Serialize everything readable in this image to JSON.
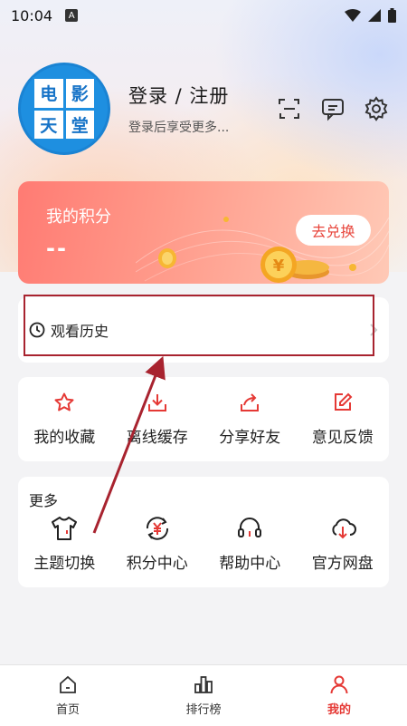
{
  "status_bar": {
    "time": "10:04",
    "notification_badge": "A"
  },
  "profile": {
    "avatar_chars": [
      "电",
      "影",
      "天",
      "堂"
    ],
    "login_title": "登录 / 注册",
    "login_subtitle": "登录后享受更多..."
  },
  "points": {
    "title": "我的积分",
    "value": "--",
    "redeem_label": "去兑换"
  },
  "history": {
    "label": "观看历史"
  },
  "quick_actions": [
    {
      "label": "我的收藏",
      "icon": "star-icon"
    },
    {
      "label": "离线缓存",
      "icon": "download-icon"
    },
    {
      "label": "分享好友",
      "icon": "share-icon"
    },
    {
      "label": "意见反馈",
      "icon": "edit-icon"
    }
  ],
  "more": {
    "title": "更多",
    "items": [
      {
        "label": "主题切换",
        "icon": "tshirt-icon"
      },
      {
        "label": "积分中心",
        "icon": "yuan-refresh-icon"
      },
      {
        "label": "帮助中心",
        "icon": "headset-icon"
      },
      {
        "label": "官方网盘",
        "icon": "cloud-download-icon"
      }
    ]
  },
  "tabs": [
    {
      "label": "首页",
      "icon": "home-icon"
    },
    {
      "label": "排行榜",
      "icon": "bar-chart-icon"
    },
    {
      "label": "我的",
      "icon": "person-icon",
      "active": true
    }
  ],
  "colors": {
    "accent": "#e53935",
    "highlight_box": "#a8232f",
    "card_gradient_start": "#ff7b73"
  }
}
